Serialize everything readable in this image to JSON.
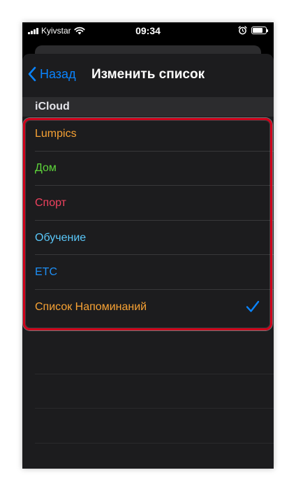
{
  "status_bar": {
    "carrier": "Kyivstar",
    "time": "09:34",
    "icons": [
      "signal-icon",
      "wifi-icon",
      "alarm-icon",
      "battery-icon"
    ]
  },
  "nav": {
    "back_label": "Назад",
    "title": "Изменить список"
  },
  "section": {
    "header": "iCloud"
  },
  "lists": [
    {
      "label": "Lumpics",
      "color": "#f7a234"
    },
    {
      "label": "Дом",
      "color": "#5ed53b"
    },
    {
      "label": "Спорт",
      "color": "#f0425f"
    },
    {
      "label": "Обучение",
      "color": "#5ac8fa"
    },
    {
      "label": "ETC",
      "color": "#1e8ff6"
    },
    {
      "label": "Список Напоминаний",
      "color": "#f7a234",
      "selected": true
    }
  ],
  "colors": {
    "accent": "#0a84ff",
    "highlight": "#d0021b",
    "sheet_bg": "#1c1c1e"
  }
}
